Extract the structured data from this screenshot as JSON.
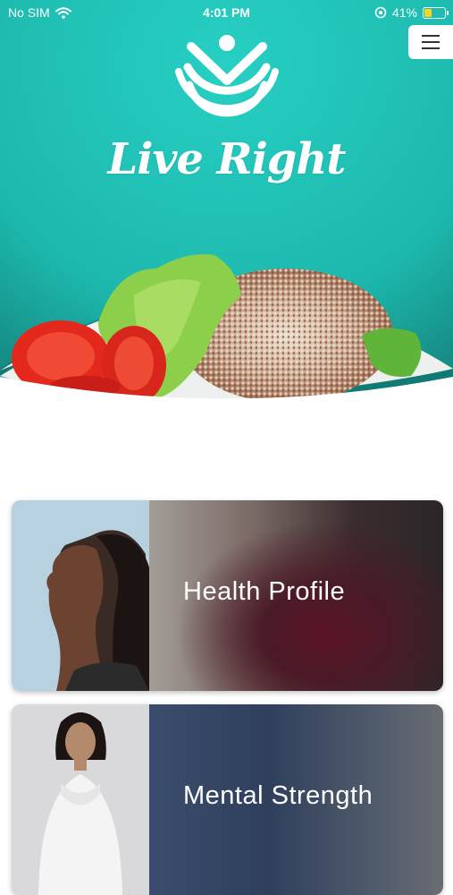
{
  "status_bar": {
    "carrier": "No SIM",
    "time": "4:01 PM",
    "battery_percent": "41%",
    "battery_level": 0.41
  },
  "app": {
    "brand_name": "Live Right",
    "brand_color": "#1dbdb2"
  },
  "menu": {
    "icon": "hamburger-menu-icon"
  },
  "cards": [
    {
      "title": "Health Profile"
    },
    {
      "title": "Mental Strength"
    }
  ]
}
